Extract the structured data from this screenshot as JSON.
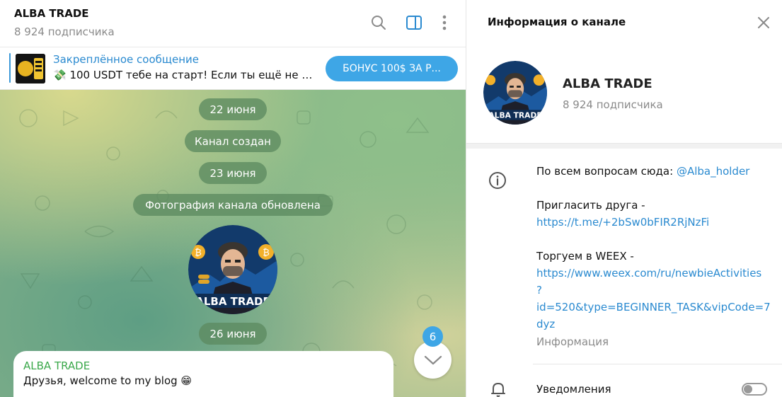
{
  "chat": {
    "title": "ALBA TRADE",
    "subscribers": "8 924 подписчика",
    "pinned": {
      "title": "Закреплённое сообщение",
      "text": "💸 100 USDT тебе на старт!  Если ты ещё не н...",
      "button": "БОНУС 100$ ЗА Р..."
    },
    "service": {
      "date1": "22 июня",
      "created": "Канал создан",
      "date2": "23 июня",
      "photo_updated": "Фотография канала обновлена",
      "date3": "26 июня"
    },
    "photo_caption": "ALBA TRADE",
    "message": {
      "author": "ALBA TRADE",
      "text": "Друзья, welcome to my blog 😁"
    },
    "unread_count": "6",
    "accent": "#3ea6e6"
  },
  "info": {
    "title": "Информация о канале",
    "name": "ALBA TRADE",
    "subscribers": "8 924 подписчика",
    "desc_line1_text": "По всем вопросам сюда: ",
    "desc_line1_link": "@Alba_holder",
    "desc_line2": "Пригласить друга -",
    "desc_line3_link": "https://t.me/+2bSw0bFIR2RjNzFi",
    "desc_line4": "Торгуем в WEEX -",
    "desc_link_a": "https://www.weex.com/ru/newbieActivities",
    "desc_link_b": "?",
    "desc_link_c": "id=520&type=BEGINNER_TASK&vipCode=7",
    "desc_link_d": "dyz",
    "desc_label": "Информация",
    "notifications": "Уведомления",
    "notifications_on": false
  }
}
